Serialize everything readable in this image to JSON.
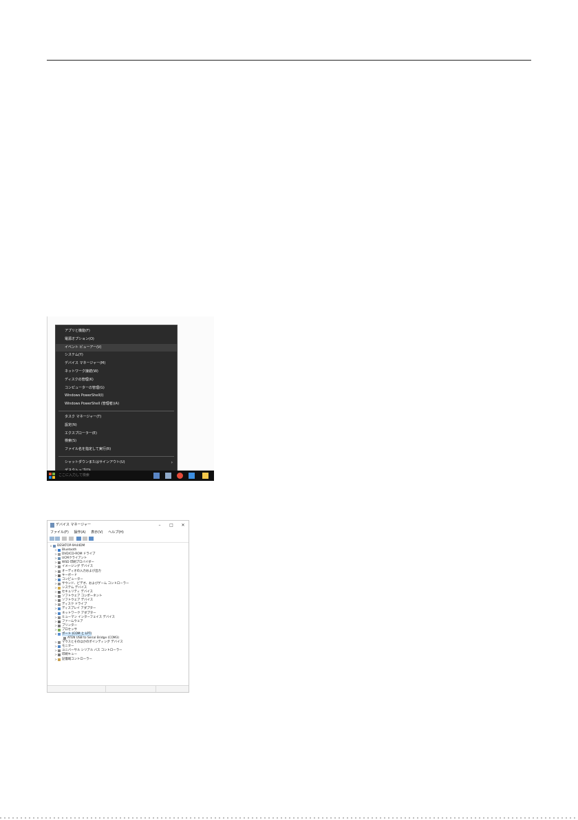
{
  "start_menu": {
    "items": [
      {
        "label": "アプリと機能(F)"
      },
      {
        "label": "電源オプション(O)"
      },
      {
        "label": "イベント ビューアー(V)",
        "highlighted": true
      },
      {
        "label": "システム(Y)"
      },
      {
        "label": "デバイス マネージャー(M)"
      },
      {
        "label": "ネットワーク接続(W)"
      },
      {
        "label": "ディスクの管理(K)"
      },
      {
        "label": "コンピューターの管理(G)"
      },
      {
        "label": "Windows PowerShell(I)"
      },
      {
        "label": "Windows PowerShell (管理者)(A)"
      },
      {
        "label": "タスク マネージャー(T)"
      },
      {
        "label": "設定(N)"
      },
      {
        "label": "エクスプローラー(E)"
      },
      {
        "label": "検索(S)"
      },
      {
        "label": "ファイル名を指定して実行(R)"
      },
      {
        "label": "シャットダウンまたはサインアウト(U)",
        "submenu": true
      },
      {
        "label": "デスクトップ(D)"
      }
    ],
    "taskbar": {
      "search_text": "ここに入力して検索",
      "icons": [
        "windows-logo",
        "app-icon",
        "app-icon",
        "chrome-icon",
        "app-icon",
        "folder-icon"
      ]
    }
  },
  "device_manager": {
    "title": "デバイス マネージャー",
    "window_controls": {
      "minimize": "–",
      "maximize": "□",
      "close": "✕"
    },
    "menu": [
      "ファイル(F)",
      "操作(A)",
      "表示(V)",
      "ヘルプ(H)"
    ],
    "root": "DESKTOP-9A44DM",
    "tree": [
      {
        "label": "Bluetooth",
        "level": 1,
        "expander": ">"
      },
      {
        "label": "DVD/CD-ROM ドライブ",
        "level": 1,
        "expander": ">"
      },
      {
        "label": "UCMクライアント",
        "level": 1,
        "expander": ">"
      },
      {
        "label": "WSD 印刷プロバイダー",
        "level": 1,
        "expander": ">"
      },
      {
        "label": "イメージング デバイス",
        "level": 1,
        "expander": ">"
      },
      {
        "label": "オーディオの入力および出力",
        "level": 1,
        "expander": ">"
      },
      {
        "label": "キーボード",
        "level": 1,
        "expander": ">"
      },
      {
        "label": "コンピューター",
        "level": 1,
        "expander": ">"
      },
      {
        "label": "サウンド、ビデオ、およびゲーム コントローラー",
        "level": 1,
        "expander": ">"
      },
      {
        "label": "システム デバイス",
        "level": 1,
        "expander": ">"
      },
      {
        "label": "セキュリティ デバイス",
        "level": 1,
        "expander": ">"
      },
      {
        "label": "ソフトウェア コンポーネント",
        "level": 1,
        "expander": ">"
      },
      {
        "label": "ソフトウェア デバイス",
        "level": 1,
        "expander": ">"
      },
      {
        "label": "ディスク ドライブ",
        "level": 1,
        "expander": ">"
      },
      {
        "label": "ディスプレイ アダプター",
        "level": 1,
        "expander": ">"
      },
      {
        "label": "ネットワーク アダプター",
        "level": 1,
        "expander": ">"
      },
      {
        "label": "ヒューマン インターフェイス デバイス",
        "level": 1,
        "expander": ">"
      },
      {
        "label": "ファームウェア",
        "level": 1,
        "expander": ">"
      },
      {
        "label": "プリンター",
        "level": 1,
        "expander": ">"
      },
      {
        "label": "プロセッサ",
        "level": 1,
        "expander": ">"
      },
      {
        "label": "ポート (COM と LPT)",
        "level": 1,
        "expander": "v",
        "selected": true
      },
      {
        "label": "ATEN USB to Serial Bridge (COM3)",
        "level": 2,
        "expander": ""
      },
      {
        "label": "マウスとそのほかのポインティング デバイス",
        "level": 1,
        "expander": ">"
      },
      {
        "label": "モニター",
        "level": 1,
        "expander": ">"
      },
      {
        "label": "ユニバーサル シリアル バス コントローラー",
        "level": 1,
        "expander": ">"
      },
      {
        "label": "印刷キュー",
        "level": 1,
        "expander": ">"
      },
      {
        "label": "記憶域コントローラー",
        "level": 1,
        "expander": ">"
      }
    ]
  },
  "colors": {
    "menu_bg": "#2b2b2b",
    "menu_text": "#f1f1f1",
    "selection": "#cce4f7",
    "taskbar": "#101010"
  }
}
